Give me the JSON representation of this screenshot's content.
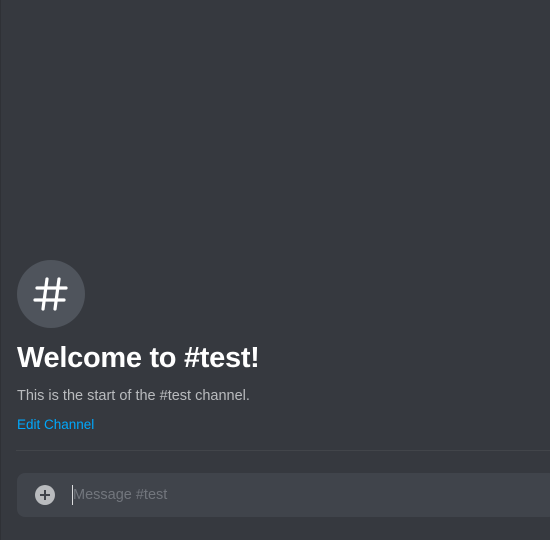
{
  "channel": {
    "welcome_title": "Welcome to #test!",
    "welcome_subtitle": "This is the start of the #test channel.",
    "edit_link_label": "Edit Channel",
    "icon": "hashtag-icon"
  },
  "composer": {
    "placeholder": "Message #test",
    "value": "",
    "attach_icon": "plus-circle-icon"
  },
  "colors": {
    "background": "#36393f",
    "icon_circle": "#4f545c",
    "title": "#ffffff",
    "subtitle": "#b9bbbe",
    "link": "#00a8fc",
    "composer_bg": "#40444b",
    "placeholder": "#72767d"
  }
}
